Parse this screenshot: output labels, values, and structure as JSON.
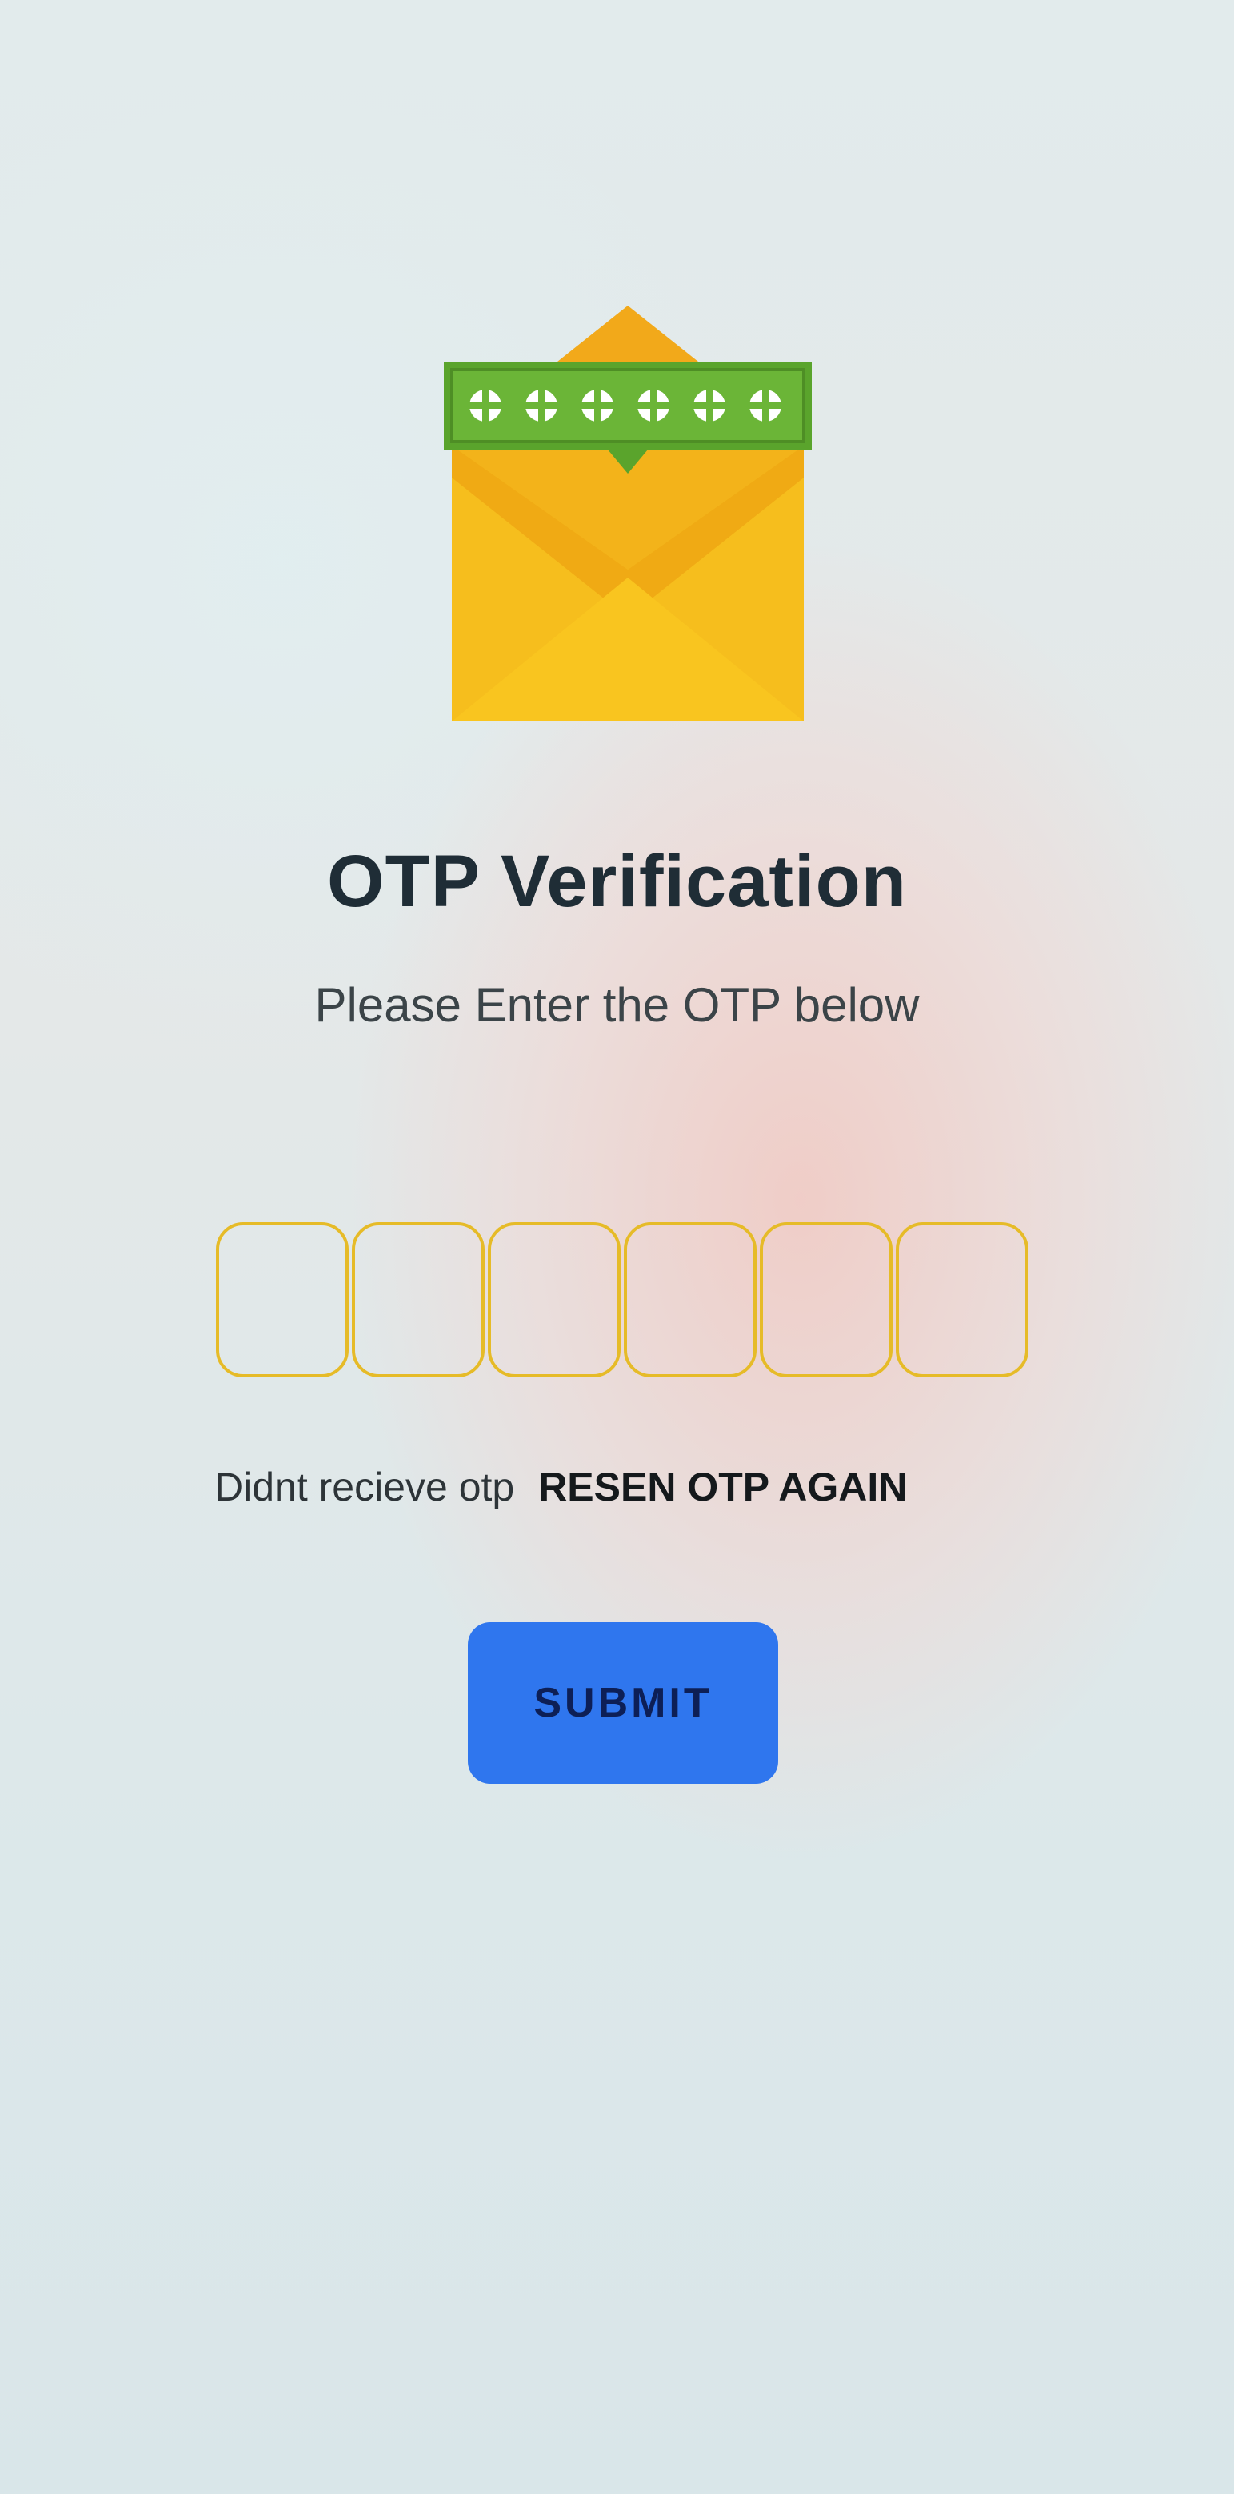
{
  "header": {
    "title": "OTP Verification",
    "subtitle": "Please Enter the OTP below"
  },
  "otp": {
    "length": 6,
    "values": [
      "",
      "",
      "",
      "",
      "",
      ""
    ]
  },
  "resend": {
    "label": "Didnt recieve otp",
    "action": "RESEN OTP AGAIN"
  },
  "submit": {
    "label": "SUBMIT"
  },
  "colors": {
    "accent": "#2f76ee",
    "otp_border": "#e6bb28",
    "envelope": "#f5bd1c",
    "password_bar": "#5aa42c"
  },
  "icons": {
    "hero": "envelope-password-icon"
  }
}
